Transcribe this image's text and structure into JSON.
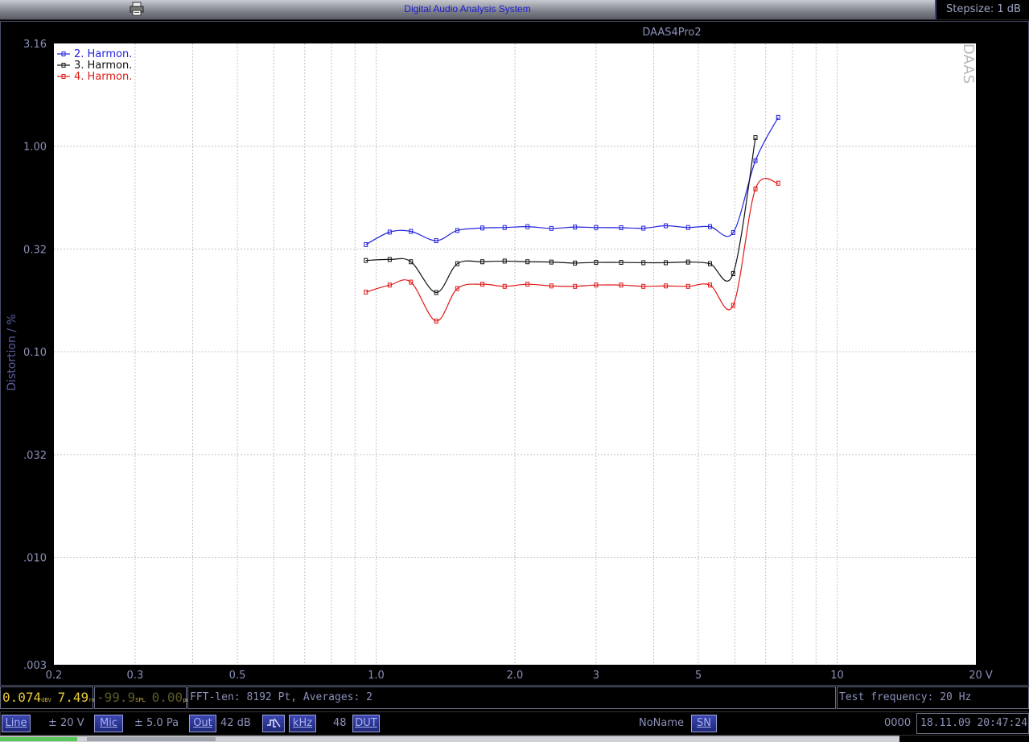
{
  "window": {
    "title": "Digital Audio Analysis System",
    "stepsize": "Stepsize: 1 dB"
  },
  "chart_data": {
    "type": "line",
    "title": "DAAS4Pro2",
    "watermark": "DAAS",
    "ylabel": "Distortion / %",
    "xlabel": "",
    "x_unit_label": "20 V",
    "x_scale": "log",
    "y_scale": "log",
    "xlim": [
      0.2,
      20
    ],
    "ylim": [
      0.003,
      3.16
    ],
    "x_ticks": [
      {
        "v": 0.2,
        "label": "0.2"
      },
      {
        "v": 0.3,
        "label": "0.3"
      },
      {
        "v": 0.5,
        "label": "0.5"
      },
      {
        "v": 1.0,
        "label": "1.0"
      },
      {
        "v": 2.0,
        "label": "2.0"
      },
      {
        "v": 3,
        "label": "3"
      },
      {
        "v": 5,
        "label": "5"
      },
      {
        "v": 10,
        "label": "10"
      }
    ],
    "y_ticks": [
      {
        "v": 3.16,
        "label": "3.16"
      },
      {
        "v": 1.0,
        "label": "1.00"
      },
      {
        "v": 0.316,
        "label": "0.32"
      },
      {
        "v": 0.1,
        "label": "0.10"
      },
      {
        "v": 0.0316,
        "label": ".032"
      },
      {
        "v": 0.01,
        "label": ".010"
      },
      {
        "v": 0.003,
        "label": ".003"
      }
    ],
    "grid": true,
    "legend_position": "top-left",
    "series": [
      {
        "name": "2. Harmon.",
        "color": "#2323e0",
        "points": [
          [
            0.95,
            0.332
          ],
          [
            1.07,
            0.382
          ],
          [
            1.19,
            0.385
          ],
          [
            1.35,
            0.347
          ],
          [
            1.5,
            0.389
          ],
          [
            1.7,
            0.4
          ],
          [
            1.9,
            0.402
          ],
          [
            2.13,
            0.406
          ],
          [
            2.4,
            0.398
          ],
          [
            2.7,
            0.404
          ],
          [
            3.0,
            0.402
          ],
          [
            3.4,
            0.401
          ],
          [
            3.8,
            0.399
          ],
          [
            4.25,
            0.41
          ],
          [
            4.75,
            0.402
          ],
          [
            5.3,
            0.406
          ],
          [
            5.95,
            0.38
          ],
          [
            6.65,
            0.85
          ],
          [
            7.45,
            1.38
          ]
        ]
      },
      {
        "name": "3. Harmon.",
        "color": "#101010",
        "points": [
          [
            0.95,
            0.278
          ],
          [
            1.07,
            0.281
          ],
          [
            1.19,
            0.274
          ],
          [
            1.35,
            0.194
          ],
          [
            1.5,
            0.268
          ],
          [
            1.7,
            0.274
          ],
          [
            1.9,
            0.276
          ],
          [
            2.13,
            0.274
          ],
          [
            2.4,
            0.273
          ],
          [
            2.7,
            0.27
          ],
          [
            3.0,
            0.272
          ],
          [
            3.4,
            0.272
          ],
          [
            3.8,
            0.271
          ],
          [
            4.25,
            0.271
          ],
          [
            4.75,
            0.273
          ],
          [
            5.3,
            0.268
          ],
          [
            5.95,
            0.24
          ],
          [
            6.65,
            1.1
          ]
        ]
      },
      {
        "name": "4. Harmon.",
        "color": "#e01818",
        "points": [
          [
            0.95,
            0.195
          ],
          [
            1.07,
            0.211
          ],
          [
            1.19,
            0.218
          ],
          [
            1.35,
            0.141
          ],
          [
            1.5,
            0.203
          ],
          [
            1.7,
            0.213
          ],
          [
            1.9,
            0.208
          ],
          [
            2.13,
            0.213
          ],
          [
            2.4,
            0.209
          ],
          [
            2.7,
            0.208
          ],
          [
            3.0,
            0.211
          ],
          [
            3.4,
            0.211
          ],
          [
            3.8,
            0.208
          ],
          [
            4.25,
            0.209
          ],
          [
            4.75,
            0.208
          ],
          [
            5.3,
            0.211
          ],
          [
            5.95,
            0.168
          ],
          [
            6.65,
            0.62
          ],
          [
            7.45,
            0.66
          ]
        ]
      }
    ]
  },
  "status": {
    "meter1_value": "0.074",
    "meter1_unit": "dBV",
    "meter2_value": "7.49",
    "meter2_unit": "rms",
    "meter3_value": "-99.9",
    "meter3_unit": "SPL",
    "meter4_value": "0.00",
    "meter4_unit": "peak",
    "fft_info": "FFT-len: 8192 Pt, Averages: 2",
    "test_frequency": "Test frequency: 20 Hz"
  },
  "toolbar": {
    "line_label": "Line",
    "line_range": "± 20 V",
    "mic_label": "Mic",
    "mic_range": "± 5.0 Pa",
    "out_label": "Out",
    "out_value": "42 dB",
    "khz_label": "kHz",
    "khz_value": "48",
    "dut_label": "DUT",
    "name_value": "NoName",
    "sn_label": "SN",
    "sn_value": "0000",
    "datetime": "18.11.09 20:47:24"
  }
}
